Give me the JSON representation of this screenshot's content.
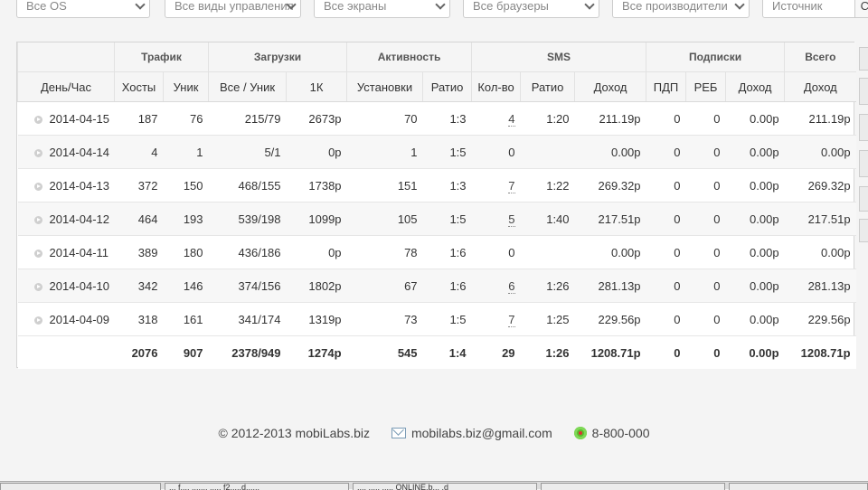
{
  "filters": {
    "os": "Все OS",
    "control": "Все виды управления",
    "screens": "Все экраны",
    "browsers": "Все браузеры",
    "vendors": "Все производители",
    "source_placeholder": "Источник",
    "source_button": "Сп"
  },
  "table": {
    "groups": {
      "traffic": "Трафик",
      "downloads": "Загрузки",
      "activity": "Активность",
      "sms": "SMS",
      "subscriptions": "Подписки",
      "total": "Всего"
    },
    "columns": [
      "День/Час",
      "Хосты",
      "Уник",
      "Все / Уник",
      "1К",
      "Установки",
      "Ратио",
      "Кол-во",
      "Ратио",
      "Доход",
      "ПДП",
      "РЕБ",
      "Доход",
      "Доход"
    ],
    "rows": [
      [
        "2014-04-15",
        "187",
        "76",
        "215/79",
        "2673р",
        "70",
        "1:3",
        "4",
        "1:20",
        "211.19р",
        "0",
        "0",
        "0.00р",
        "211.19р"
      ],
      [
        "2014-04-14",
        "4",
        "1",
        "5/1",
        "0р",
        "1",
        "1:5",
        "0",
        "",
        "0.00р",
        "0",
        "0",
        "0.00р",
        "0.00р"
      ],
      [
        "2014-04-13",
        "372",
        "150",
        "468/155",
        "1738р",
        "151",
        "1:3",
        "7",
        "1:22",
        "269.32р",
        "0",
        "0",
        "0.00р",
        "269.32р"
      ],
      [
        "2014-04-12",
        "464",
        "193",
        "539/198",
        "1099р",
        "105",
        "1:5",
        "5",
        "1:40",
        "217.51р",
        "0",
        "0",
        "0.00р",
        "217.51р"
      ],
      [
        "2014-04-11",
        "389",
        "180",
        "436/186",
        "0р",
        "78",
        "1:6",
        "0",
        "",
        "0.00р",
        "0",
        "0",
        "0.00р",
        "0.00р"
      ],
      [
        "2014-04-10",
        "342",
        "146",
        "374/156",
        "1802р",
        "67",
        "1:6",
        "6",
        "1:26",
        "281.13р",
        "0",
        "0",
        "0.00р",
        "281.13р"
      ],
      [
        "2014-04-09",
        "318",
        "161",
        "341/174",
        "1319р",
        "73",
        "1:5",
        "7",
        "1:25",
        "229.56р",
        "0",
        "0",
        "0.00р",
        "229.56р"
      ]
    ],
    "totals": [
      "",
      "2076",
      "907",
      "2378/949",
      "1274р",
      "545",
      "1:4",
      "29",
      "1:26",
      "1208.71р",
      "0",
      "0",
      "0.00р",
      "1208.71р"
    ]
  },
  "footer": {
    "copyright": "© 2012-2013 mobiLabs.biz",
    "email": "mobilabs.biz@gmail.com",
    "phone": "8-800-000"
  },
  "taskbar": {
    "item1": "... f.... ....... ..... f2.....d......",
    "item2": ".... ..... ..... ONLINE.b... .d",
    "item3": "",
    "item4": ""
  }
}
